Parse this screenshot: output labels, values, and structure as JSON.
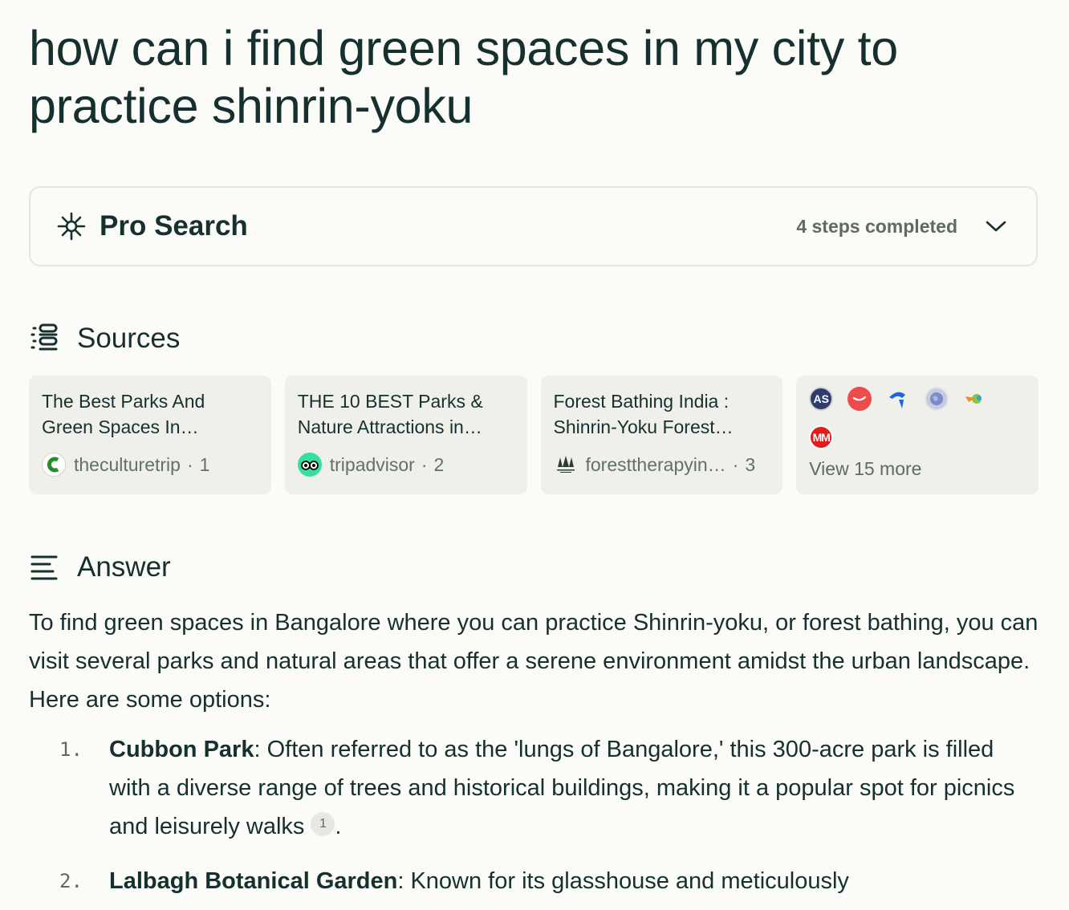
{
  "query": {
    "title": "how can i find green spaces in my city to practice shinrin-yoku"
  },
  "pro_search": {
    "label": "Pro Search",
    "steps": "4 steps completed"
  },
  "sources": {
    "heading": "Sources",
    "cards": [
      {
        "title": "The Best Parks And Green Spaces In…",
        "domain": "theculturetrip",
        "index": "1"
      },
      {
        "title": "THE 10 BEST Parks & Nature Attractions in…",
        "domain": "tripadvisor",
        "index": "2"
      },
      {
        "title": "Forest Bathing India : Shinrin-Yoku Forest…",
        "domain": "foresttherapyin…",
        "index": "3"
      }
    ],
    "more": {
      "label": "View 15 more",
      "icons": [
        "AS",
        "",
        "",
        "",
        "",
        "MM"
      ]
    }
  },
  "answer": {
    "heading": "Answer",
    "intro": "To find green spaces in Bangalore where you can practice Shinrin-yoku, or forest bathing, you can visit several parks and natural areas that offer a serene environment amidst the urban landscape. Here are some options:",
    "items": [
      {
        "num": "1.",
        "name": "Cubbon Park",
        "text": ": Often referred to as the 'lungs of Bangalore,' this 300-acre park is filled with a diverse range of trees and historical buildings, making it a popular spot for picnics and leisurely walks",
        "cite": "1",
        "end": "."
      },
      {
        "num": "2.",
        "name": "Lalbagh Botanical Garden",
        "text": ": Known for its glasshouse and meticulously"
      }
    ]
  },
  "colors": {
    "text": "#16302f",
    "muted": "#5f6966",
    "card": "#f0f0eb",
    "border": "#e7e7e2",
    "background": "#fbfbf7"
  }
}
